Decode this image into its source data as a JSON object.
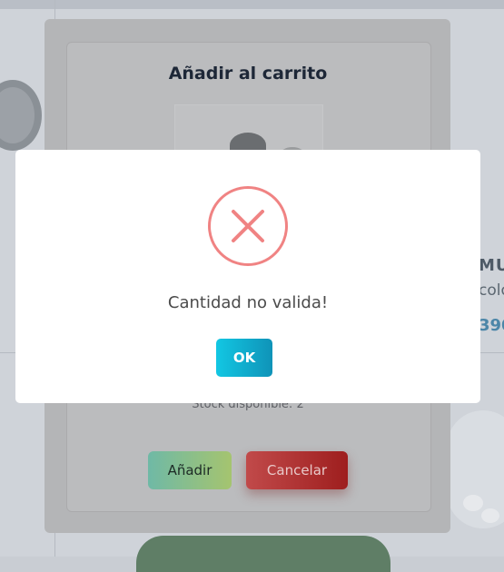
{
  "background": {
    "right_text_1": "MU",
    "right_text_2": "colo",
    "right_price": "390"
  },
  "cart_dialog": {
    "title": "Añadir al carrito",
    "stock_text": "Stock disponible: 2",
    "add_button_label": "Añadir",
    "cancel_button_label": "Cancelar"
  },
  "alert": {
    "icon": "error-x-icon",
    "message": "Cantidad no valida!",
    "ok_label": "OK",
    "icon_color": "#f08383"
  }
}
